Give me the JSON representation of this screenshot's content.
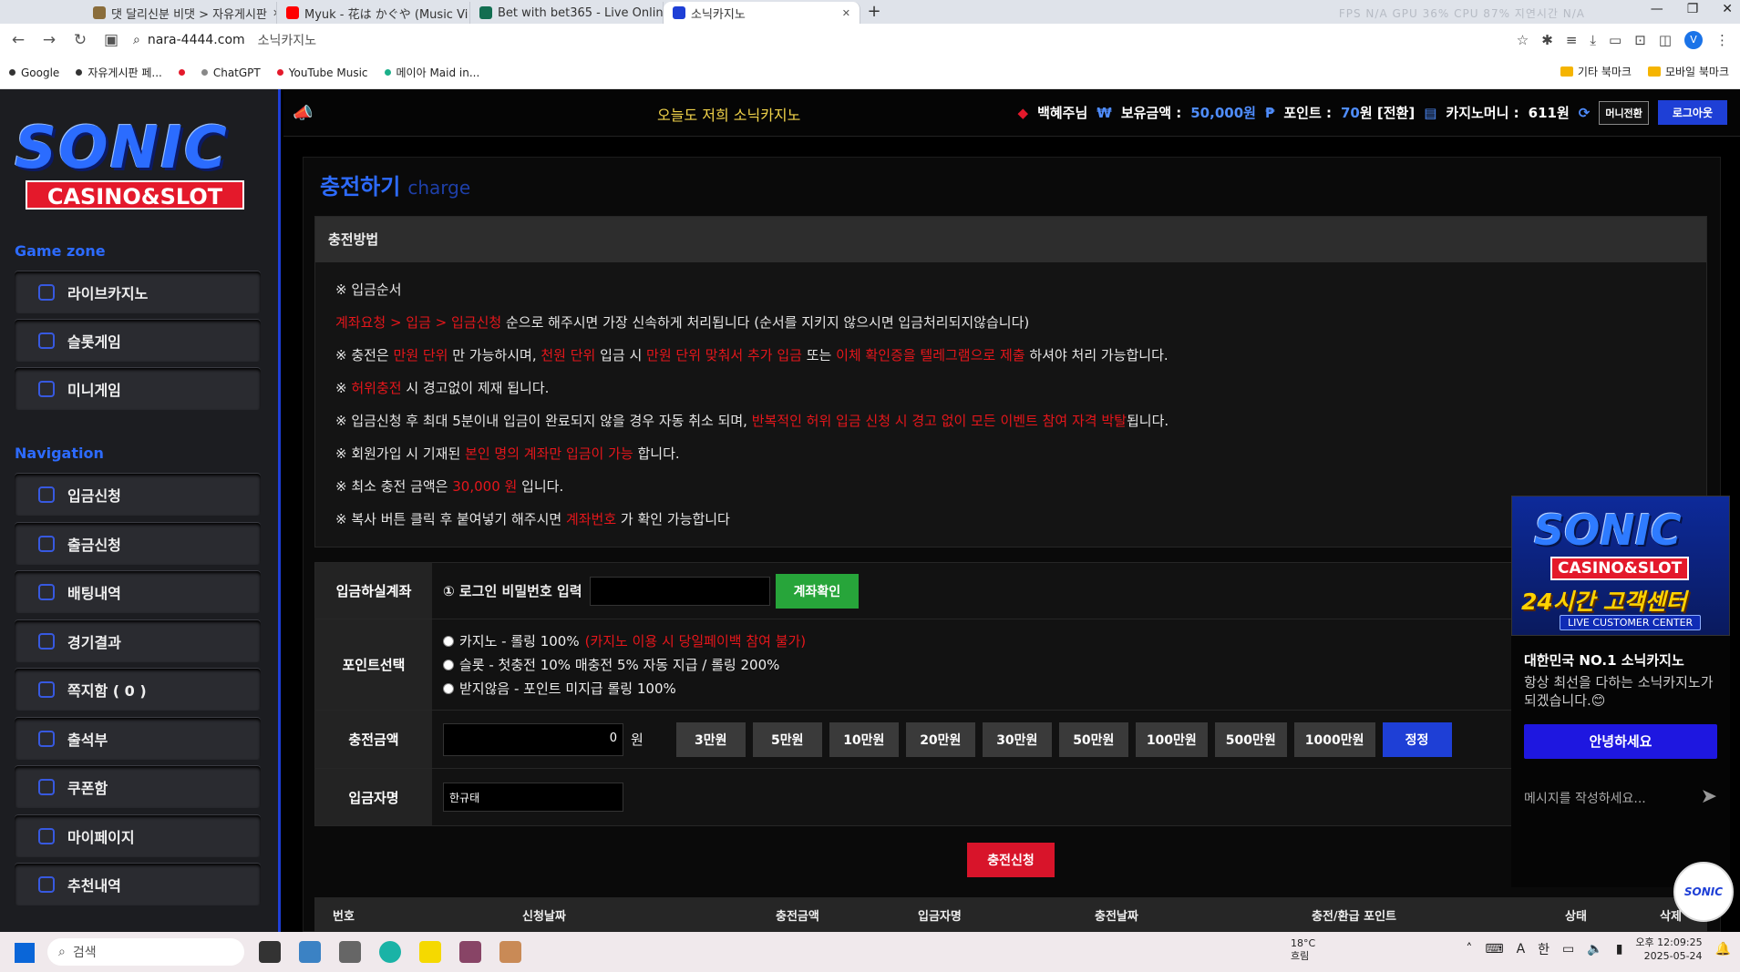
{
  "browser": {
    "tabs": [
      {
        "label": "댓 달리신분 비댓 > 자유게시판",
        "color": "#8a6d3b"
      },
      {
        "label": "Myuk - 花は かぐや (Music Vi",
        "color": "#ff0000"
      },
      {
        "label": "Bet with bet365 - Live Online",
        "color": "#126e51"
      },
      {
        "label": "소닉카지노",
        "color": "#1e3fd6"
      }
    ],
    "new_tab": "+",
    "perf": "FPS N/A   GPU 36%   CPU 87%   지연시간 N/A",
    "url_host": "nara-4444.com",
    "url_page": "소닉카지노",
    "profile": "V",
    "bookmarks": [
      {
        "label": "Google",
        "color": "#333"
      },
      {
        "label": "자유게시판 페...",
        "color": "#333"
      },
      {
        "label": "",
        "color": "#e4192b"
      },
      {
        "label": "ChatGPT",
        "color": "#888"
      },
      {
        "label": "YouTube Music",
        "color": "#e4192b"
      },
      {
        "label": "메이아 Maid in...",
        "color": "#1bb08a"
      }
    ],
    "bookmark_folders": [
      "기타 북마크",
      "모바일 북마크"
    ]
  },
  "sidebar": {
    "logo_main": "SONIC",
    "logo_sub": "CASINO&SLOT",
    "section1": "Game zone",
    "game_items": [
      "라이브카지노",
      "슬롯게임",
      "미니게임"
    ],
    "section2": "Navigation",
    "nav_items": [
      "입금신청",
      "출금신청",
      "배팅내역",
      "경기결과",
      "쪽지함 ( 0 )",
      "출석부",
      "쿠폰함",
      "마이페이지",
      "추천내역"
    ]
  },
  "topbar": {
    "marquee": "오늘도 저희 소닉카지노",
    "username": "백혜주님",
    "balance_label": "보유금액 :",
    "balance_value": "50,000원",
    "point_label": "포인트 :",
    "point_value": "70",
    "point_suffix": "원 [전환]",
    "casino_label": "카지노머니 :",
    "casino_value": "611원",
    "exchange_btn": "머니전환",
    "logout_btn": "로그아웃",
    "colors": {
      "accent": "#1e3fd6",
      "highlight": "#4f8dff"
    }
  },
  "page": {
    "title": "충전하기",
    "title_en": "charge",
    "howto_title": "충전방법",
    "lines": [
      [
        {
          "t": "※ 입금순서",
          "r": false
        }
      ],
      [
        {
          "t": "계좌요청 > 입금 > 입금신청",
          "r": true
        },
        {
          "t": " 순으로 해주시면 가장 신속하게 처리됩니다 (순서를 지키지 않으시면 입금처리되지않습니다)",
          "r": false
        }
      ],
      [
        {
          "t": "※ 충전은 ",
          "r": false
        },
        {
          "t": "만원 단위",
          "r": true
        },
        {
          "t": " 만 가능하시며, ",
          "r": false
        },
        {
          "t": "천원 단위",
          "r": true
        },
        {
          "t": " 입금 시 ",
          "r": false
        },
        {
          "t": "만원 단위 맞춰서 추가 입금",
          "r": true
        },
        {
          "t": " 또는 ",
          "r": false
        },
        {
          "t": "이체 확인증을 텔레그램으로 제출",
          "r": true
        },
        {
          "t": " 하셔야 처리 가능합니다.",
          "r": false
        }
      ],
      [
        {
          "t": "※ ",
          "r": false
        },
        {
          "t": "허위충전",
          "r": true
        },
        {
          "t": " 시 경고없이 제재 됩니다.",
          "r": false
        }
      ],
      [
        {
          "t": "※ 입금신청 후 최대 5분이내 입금이 완료되지 않을 경우 자동 취소 되며, ",
          "r": false
        },
        {
          "t": "반복적인 허위 입금 신청 시 경고 없이 모든 이벤트 참여 자격 박탈",
          "r": true
        },
        {
          "t": "됩니다.",
          "r": false
        }
      ],
      [
        {
          "t": "※ 회원가입 시 기재된 ",
          "r": false
        },
        {
          "t": "본인 명의 계좌만 입금이 가능",
          "r": true
        },
        {
          "t": " 합니다.",
          "r": false
        }
      ],
      [
        {
          "t": "※ 최소 충전 금액은 ",
          "r": false
        },
        {
          "t": "30,000 원",
          "r": true
        },
        {
          "t": " 입니다.",
          "r": false
        }
      ],
      [
        {
          "t": "※ 복사 버튼 클릭 후 붙여넣기 해주시면 ",
          "r": false
        },
        {
          "t": "계좌번호",
          "r": true
        },
        {
          "t": " 가 확인 가능합니다",
          "r": false
        }
      ]
    ],
    "form": {
      "account_label": "입금하실계좌",
      "account_prompt": "① 로그인 비밀번호 입력",
      "account_btn": "계좌확인",
      "point_label": "포인트선택",
      "point_opts": [
        {
          "main": "카지노 - 롤링 100% ",
          "red": "(카지노 이용 시 당일페이백 참여 불가)"
        },
        {
          "main": "슬롯 - 첫충전 10% 매충전 5% 자동 지급 / 롤링 200%",
          "red": ""
        },
        {
          "main": "받지않음 - 포인트 미지급 롤링 100%",
          "red": ""
        }
      ],
      "amount_label": "충전금액",
      "amount_value": "0",
      "amount_unit": "원",
      "amount_btns": [
        "3만원",
        "5만원",
        "10만원",
        "20만원",
        "30만원",
        "50만원",
        "100만원",
        "500만원",
        "1000만원"
      ],
      "reset_btn": "정정",
      "name_label": "입금자명",
      "name_value": "한규태"
    },
    "submit": "충전신청",
    "history_cols": [
      "번호",
      "신청날짜",
      "충전금액",
      "입금자명",
      "충전날짜",
      "충전/환급 포인트",
      "상태",
      "삭제"
    ]
  },
  "chat": {
    "banner_main": "SONIC",
    "banner_sub": "CASINO&SLOT",
    "banner_headline": "24시간 고객센터",
    "banner_label": "LIVE CUSTOMER CENTER",
    "title": "대한민국 NO.1 소닉카지노",
    "desc": "항상 최선을 다하는 소닉카지노가 되겠습니다.😊",
    "hello_btn": "안녕하세요",
    "input_placeholder": "메시지를 작성하세요...",
    "avatar_text": "SONIC"
  },
  "taskbar": {
    "search": "검색",
    "weather_temp": "18°C",
    "weather_desc": "흐림",
    "ime": "한",
    "ime_a": "A",
    "time": "오후 12:09:25",
    "date": "2025-05-24"
  }
}
